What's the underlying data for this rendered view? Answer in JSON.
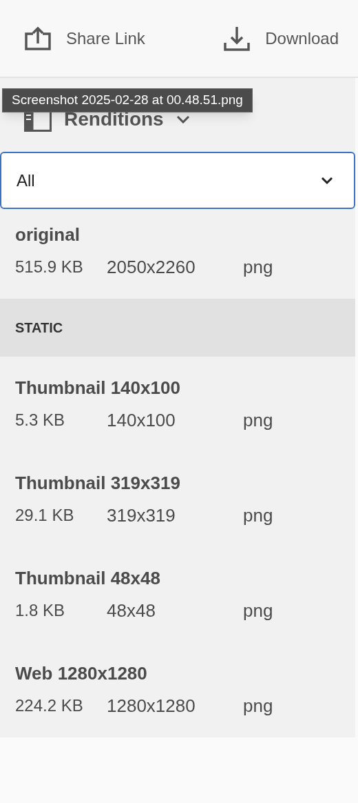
{
  "actions": [
    {
      "kind": "share",
      "label": "Share Link"
    },
    {
      "kind": "download",
      "label": "Download"
    }
  ],
  "tooltip": "Screenshot 2025-02-28 at 00.48.51.png",
  "panel": {
    "title": "Renditions"
  },
  "filter": {
    "value": "All"
  },
  "original": {
    "name": "original",
    "size": "515.9 KB",
    "dimensions": "2050x2260",
    "type": "png"
  },
  "section": "STATIC",
  "renditions": [
    {
      "name": "Thumbnail 140x100",
      "size": "5.3 KB",
      "dimensions": "140x100",
      "type": "png"
    },
    {
      "name": "Thumbnail 319x319",
      "size": "29.1 KB",
      "dimensions": "319x319",
      "type": "png"
    },
    {
      "name": "Thumbnail 48x48",
      "size": "1.8 KB",
      "dimensions": "48x48",
      "type": "png"
    },
    {
      "name": "Web 1280x1280",
      "size": "224.2 KB",
      "dimensions": "1280x1280",
      "type": "png"
    }
  ]
}
